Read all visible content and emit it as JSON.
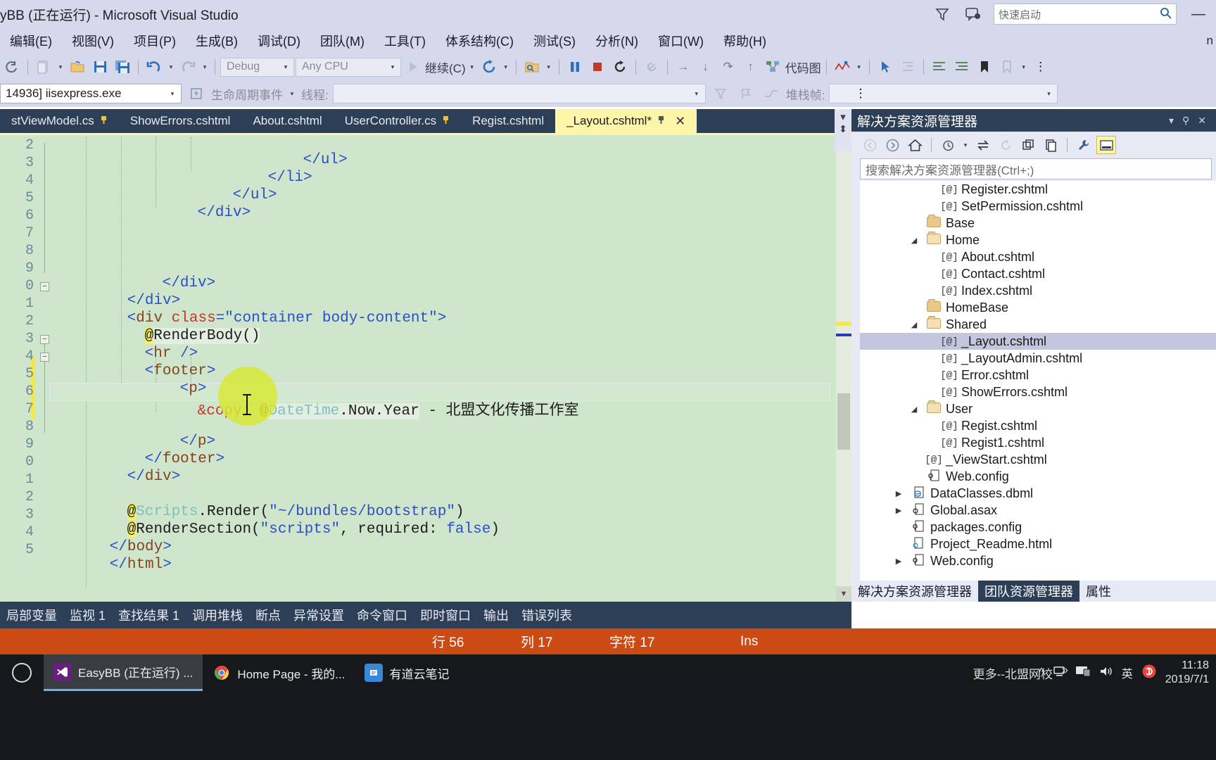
{
  "titlebar": {
    "title": "yBB (正在运行) - Microsoft Visual Studio",
    "quick_launch_placeholder": "快速启动",
    "icons": {
      "feedback": "funnel-icon",
      "notify": "notification-icon",
      "search": "search-icon"
    },
    "window_buttons": {
      "minimize": "—",
      "maximize": "❐",
      "close": "✕"
    }
  },
  "menubar": {
    "items": [
      {
        "label": "编辑(E)"
      },
      {
        "label": "视图(V)"
      },
      {
        "label": "项目(P)"
      },
      {
        "label": "生成(B)"
      },
      {
        "label": "调试(D)"
      },
      {
        "label": "团队(M)"
      },
      {
        "label": "工具(T)"
      },
      {
        "label": "体系结构(C)"
      },
      {
        "label": "测试(S)"
      },
      {
        "label": "分析(N)"
      },
      {
        "label": "窗口(W)"
      },
      {
        "label": "帮助(H)"
      }
    ],
    "overflow": "n"
  },
  "toolbar": {
    "config": "Debug",
    "platform": "Any CPU",
    "continue_label": "继续(C)",
    "code_map_label": "代码图"
  },
  "procbar": {
    "process": "14936] iisexpress.exe",
    "lifecycle_label": "生命周期事件",
    "thread_label": "线程:",
    "stack_label": "堆栈帧:"
  },
  "editor": {
    "tabs": [
      {
        "label": "stViewModel.cs",
        "pinned": true,
        "active": false
      },
      {
        "label": "ShowErrors.cshtml",
        "pinned": false,
        "active": false
      },
      {
        "label": "About.cshtml",
        "pinned": false,
        "active": false
      },
      {
        "label": "UserController.cs",
        "pinned": true,
        "active": false
      },
      {
        "label": "Regist.cshtml",
        "pinned": false,
        "active": false
      },
      {
        "label": "_Layout.cshtml*",
        "pinned": true,
        "active": true
      }
    ],
    "line_numbers": [
      "2",
      "3",
      "4",
      "5",
      "6",
      "7",
      "8",
      "9",
      "0",
      "1",
      "2",
      "3",
      "4",
      "5",
      "6",
      "7",
      "8",
      "9",
      "0",
      "1",
      "2",
      "3",
      "4",
      "5"
    ],
    "lines": [
      "</ul>",
      "</li>",
      "</ul>",
      "</div>",
      "",
      "",
      "</div>",
      "</div>",
      "<div class=\"container body-content\">",
      "@RenderBody()",
      "<hr />",
      "<footer>",
      "<p>",
      "&copy; @DateTime.Now.Year - 北盟文化传播工作室",
      "",
      "</p>",
      "</footer>",
      "</div>",
      "",
      "@Scripts.Render(\"~/bundles/bootstrap\")",
      "@RenderSection(\"scripts\", required: false)",
      "</body>",
      "</html>",
      ""
    ],
    "code_fragments": {
      "div_class_open": "<div class=\"container body-content\">",
      "render_body": "@RenderBody()",
      "hr": "<hr />",
      "footer_open": "<footer>",
      "p_open": "<p>",
      "copy_entity": "&copy;",
      "at": "@",
      "datetime": "DateTime",
      "now_year": ".Now.Year",
      "dash": "-",
      "studio_name": "北盟文化传播工作室",
      "p_close": "</p>",
      "footer_close": "</footer>",
      "div_close": "</div>",
      "scripts_render_at": "@",
      "scripts_word": "Scripts",
      "scripts_rest": ".Render(",
      "bundle_path": "\"~/bundles/bootstrap\"",
      "paren_close": ")",
      "render_section_at": "@",
      "render_section": "RenderSection(",
      "scripts_str": "\"scripts\"",
      "required_txt": ", required: ",
      "false_kw": "false",
      "body_close": "</body>",
      "html_close": "</html>",
      "ul_close": "</ul>",
      "li_close": "</li>"
    }
  },
  "solution": {
    "title": "解决方案资源管理器",
    "search_placeholder": "搜索解决方案资源管理器(Ctrl+;)",
    "toolbar_icons": [
      "back-icon",
      "forward-icon",
      "home-icon",
      "history-icon",
      "sync-icon",
      "refresh-icon",
      "collapse-all-icon",
      "show-all-files-icon",
      "properties-icon",
      "wrench-icon",
      "preview-icon"
    ],
    "tree": [
      {
        "indent": 4,
        "type": "cshtml",
        "label": "Register.cshtml",
        "expander": "",
        "selected": false
      },
      {
        "indent": 4,
        "type": "cshtml",
        "label": "SetPermission.cshtml",
        "expander": "",
        "selected": false
      },
      {
        "indent": 3,
        "type": "folder",
        "label": "Base",
        "expander": "",
        "selected": false
      },
      {
        "indent": 3,
        "type": "folder-open",
        "label": "Home",
        "expander": "▼",
        "selected": false
      },
      {
        "indent": 4,
        "type": "cshtml",
        "label": "About.cshtml",
        "expander": "",
        "selected": false
      },
      {
        "indent": 4,
        "type": "cshtml",
        "label": "Contact.cshtml",
        "expander": "",
        "selected": false
      },
      {
        "indent": 4,
        "type": "cshtml",
        "label": "Index.cshtml",
        "expander": "",
        "selected": false
      },
      {
        "indent": 3,
        "type": "folder",
        "label": "HomeBase",
        "expander": "",
        "selected": false
      },
      {
        "indent": 3,
        "type": "folder-open",
        "label": "Shared",
        "expander": "▼",
        "selected": false
      },
      {
        "indent": 4,
        "type": "cshtml",
        "label": "_Layout.cshtml",
        "expander": "",
        "selected": true
      },
      {
        "indent": 4,
        "type": "cshtml",
        "label": "_LayoutAdmin.cshtml",
        "expander": "",
        "selected": false
      },
      {
        "indent": 4,
        "type": "cshtml",
        "label": "Error.cshtml",
        "expander": "",
        "selected": false
      },
      {
        "indent": 4,
        "type": "cshtml",
        "label": "ShowErrors.cshtml",
        "expander": "",
        "selected": false
      },
      {
        "indent": 3,
        "type": "folder-open",
        "label": "User",
        "expander": "▼",
        "selected": false
      },
      {
        "indent": 4,
        "type": "cshtml",
        "label": "Regist.cshtml",
        "expander": "",
        "selected": false
      },
      {
        "indent": 4,
        "type": "cshtml",
        "label": "Regist1.cshtml",
        "expander": "",
        "selected": false
      },
      {
        "indent": 3,
        "type": "cshtml",
        "label": "_ViewStart.cshtml",
        "expander": "",
        "selected": false
      },
      {
        "indent": 3,
        "type": "config",
        "label": "Web.config",
        "expander": "",
        "selected": false
      },
      {
        "indent": 2,
        "type": "dbml",
        "label": "DataClasses.dbml",
        "expander": "▶",
        "selected": false
      },
      {
        "indent": 2,
        "type": "asax",
        "label": "Global.asax",
        "expander": "▶",
        "selected": false
      },
      {
        "indent": 2,
        "type": "config",
        "label": "packages.config",
        "expander": "",
        "selected": false
      },
      {
        "indent": 2,
        "type": "html",
        "label": "Project_Readme.html",
        "expander": "",
        "selected": false
      },
      {
        "indent": 2,
        "type": "config",
        "label": "Web.config",
        "expander": "▶",
        "selected": false
      }
    ],
    "panel_tabs": [
      {
        "label": "解决方案资源管理器",
        "active": true
      },
      {
        "label": "团队资源管理器",
        "active": false
      },
      {
        "label": "属性",
        "active": false
      }
    ]
  },
  "bottom_tabs": [
    {
      "label": "局部变量"
    },
    {
      "label": "监视 1"
    },
    {
      "label": "查找结果 1"
    },
    {
      "label": "调用堆栈"
    },
    {
      "label": "断点"
    },
    {
      "label": "异常设置"
    },
    {
      "label": "命令窗口"
    },
    {
      "label": "即时窗口"
    },
    {
      "label": "输出"
    },
    {
      "label": "错误列表"
    }
  ],
  "statusbar": {
    "line": "行 56",
    "column": "列 17",
    "char": "字符 17",
    "insert_mode": "Ins",
    "accent_color": "#cc4a14"
  },
  "taskbar": {
    "items": [
      {
        "label": "EasyBB (正在运行) ...",
        "icon": "visual-studio-icon",
        "active": true
      },
      {
        "label": "Home Page - 我的...",
        "icon": "chrome-icon",
        "active": false
      },
      {
        "label": "有道云笔记",
        "icon": "youdao-icon",
        "active": false
      }
    ],
    "promo": "更多--北盟网校",
    "tray": [
      "^",
      "network-icon",
      "monitor-icon",
      "volume-icon",
      "英",
      "sogou-icon"
    ],
    "clock_time": "11:18",
    "clock_date": "2019/7/1"
  }
}
